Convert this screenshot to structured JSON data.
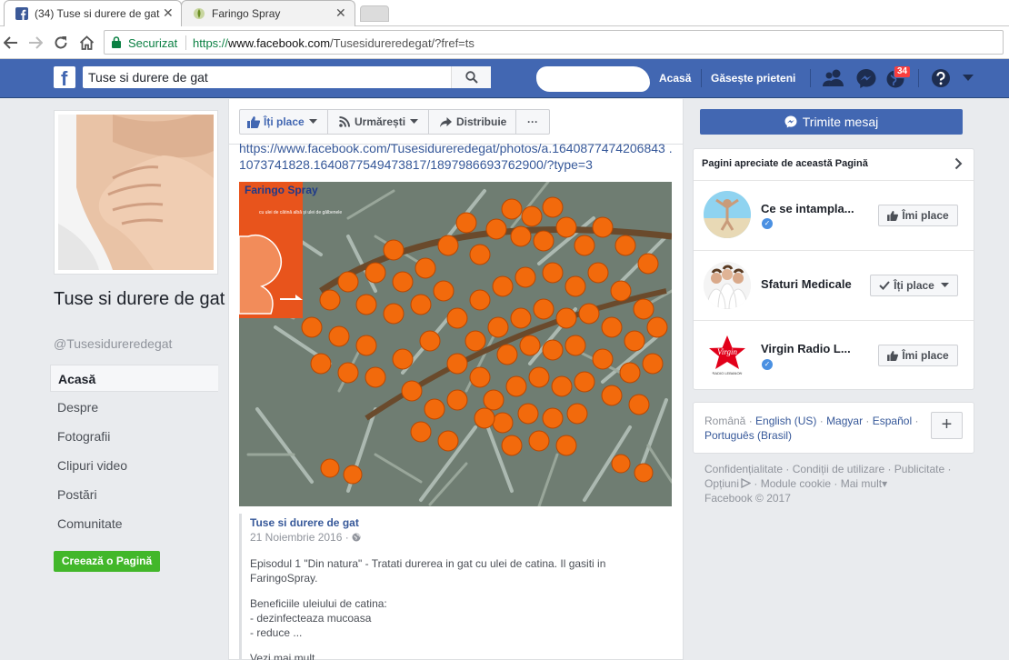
{
  "browser": {
    "tabs": [
      {
        "title": "(34) Tuse si durere de gat",
        "active": true
      },
      {
        "title": "Faringo Spray",
        "active": false
      }
    ],
    "secure_label": "Securizat",
    "url_scheme": "https://",
    "url_host": "www.facebook.com",
    "url_path": "/Tusesidureredegat/?fref=ts"
  },
  "fb": {
    "search_value": "Tuse si durere de gat",
    "nav_home": "Acasă",
    "nav_find_friends": "Găsește prieteni",
    "notification_count": "34"
  },
  "page": {
    "name": "Tuse si durere de gat",
    "handle": "@Tusesidureredegat",
    "nav": [
      "Acasă",
      "Despre",
      "Fotografii",
      "Clipuri video",
      "Postări",
      "Comunitate"
    ],
    "create_page": "Creează o Pagină"
  },
  "actions": {
    "like": "Îți place",
    "follow": "Urmărești",
    "share": "Distribuie",
    "more": "···",
    "message": "Trimite mesaj"
  },
  "post": {
    "url_text": "https://www.facebook.com/Tusesidureredegat/photos/a.1640877474206843 .1073741828.1640877549473817/1897986693762900/?type=3",
    "image_brand": "Faringo Spray",
    "image_sub": "cu ulei de cătină albă și ulei de gălbenele",
    "embed_title": "Tuse si durere de gat",
    "embed_date": "21 Noiembrie 2016 · ",
    "embed_p1": "Episodul 1 \"Din natura\" - Tratati durerea in gat cu ulei de catina. Il gasiti in FaringoSpray.",
    "embed_p2": "Beneficiile uleiului de catina:\n- dezinfecteaza mucoasa\n- reduce ...",
    "embed_more": "Vezi mai mult"
  },
  "liked_pages": {
    "header": "Pagini apreciate de această Pagină",
    "items": [
      {
        "name": "Ce se intampla...",
        "button": "Îmi place"
      },
      {
        "name": "Sfaturi Medicale",
        "button": "Îți place"
      },
      {
        "name": "Virgin Radio L...",
        "button": "Îmi place"
      }
    ],
    "virgin_logo_text": "Virgin",
    "virgin_logo_sub": "RADIO LEBANON"
  },
  "languages": {
    "current": "Română",
    "others": [
      "English (US)",
      "Magyar",
      "Español",
      "Português (Brasil)"
    ],
    "plus": "+"
  },
  "footer": {
    "links": [
      "Confidențialitate",
      "Condiții de utilizare",
      "Publicitate",
      "Opțiuni",
      "Module cookie",
      "Mai mult"
    ],
    "copyright": "Facebook © 2017"
  },
  "colors": {
    "fb_blue": "#4267b2",
    "link_blue": "#365899",
    "green": "#42b72a",
    "badge_red": "#fa3e3e"
  }
}
